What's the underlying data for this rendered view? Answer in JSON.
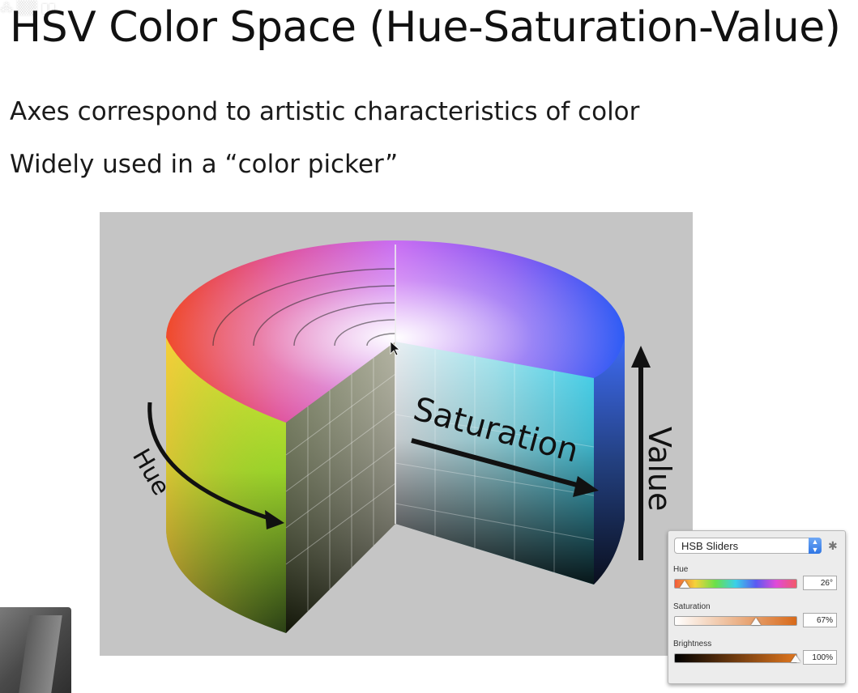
{
  "slide": {
    "title": "HSV Color Space (Hue-Saturation-Value)",
    "bullets": [
      "Axes correspond to artistic characteristics of color",
      "Widely used in a “color picker”"
    ]
  },
  "figure": {
    "labels": {
      "hue": "Hue",
      "saturation": "Saturation",
      "value": "Value"
    }
  },
  "picker": {
    "mode": "HSB Sliders",
    "hue_label": "Hue",
    "hue_value": "26°",
    "hue_fraction": 0.072,
    "saturation_label": "Saturation",
    "saturation_value": "67%",
    "saturation_fraction": 0.67,
    "brightness_label": "Brightness",
    "brightness_value": "100%",
    "brightness_fraction": 1.0,
    "accent_color": "#2f76e4"
  }
}
